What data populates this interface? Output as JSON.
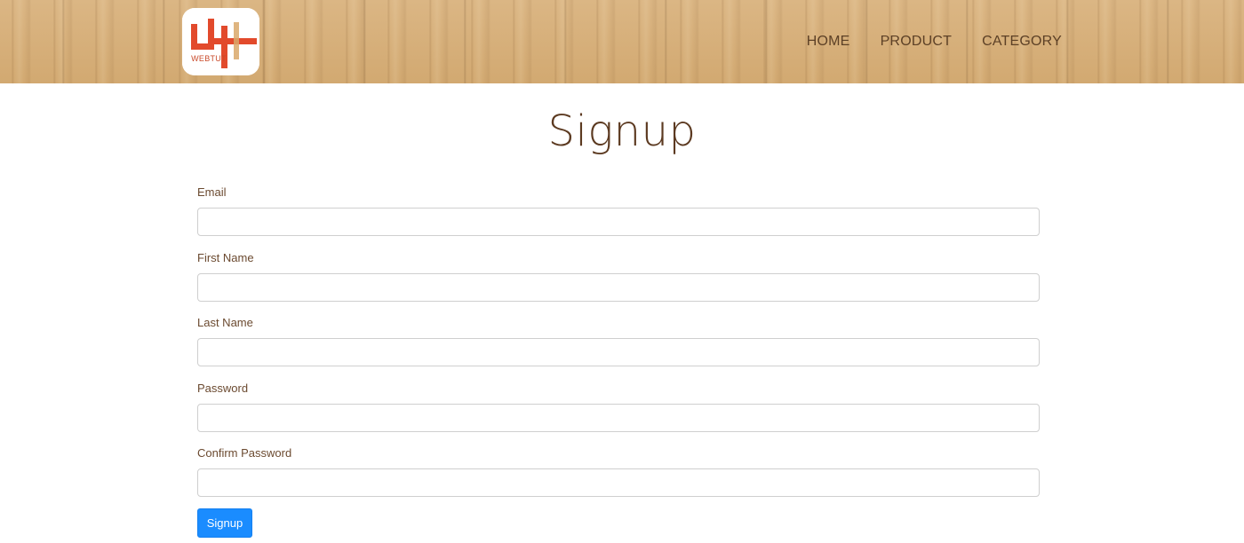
{
  "header": {
    "logo_text": "WEBTUT",
    "nav": [
      {
        "label": "HOME"
      },
      {
        "label": "PRODUCT"
      },
      {
        "label": "CATEGORY"
      }
    ]
  },
  "page": {
    "title": "Signup"
  },
  "form": {
    "fields": [
      {
        "label": "Email",
        "value": ""
      },
      {
        "label": "First Name",
        "value": ""
      },
      {
        "label": "Last Name",
        "value": ""
      },
      {
        "label": "Password",
        "value": ""
      },
      {
        "label": "Confirm Password",
        "value": ""
      }
    ],
    "submit_label": "Signup"
  },
  "colors": {
    "accent": "#1a8cff",
    "brand_red": "#e24a2c",
    "wood": "#d6b07a"
  }
}
